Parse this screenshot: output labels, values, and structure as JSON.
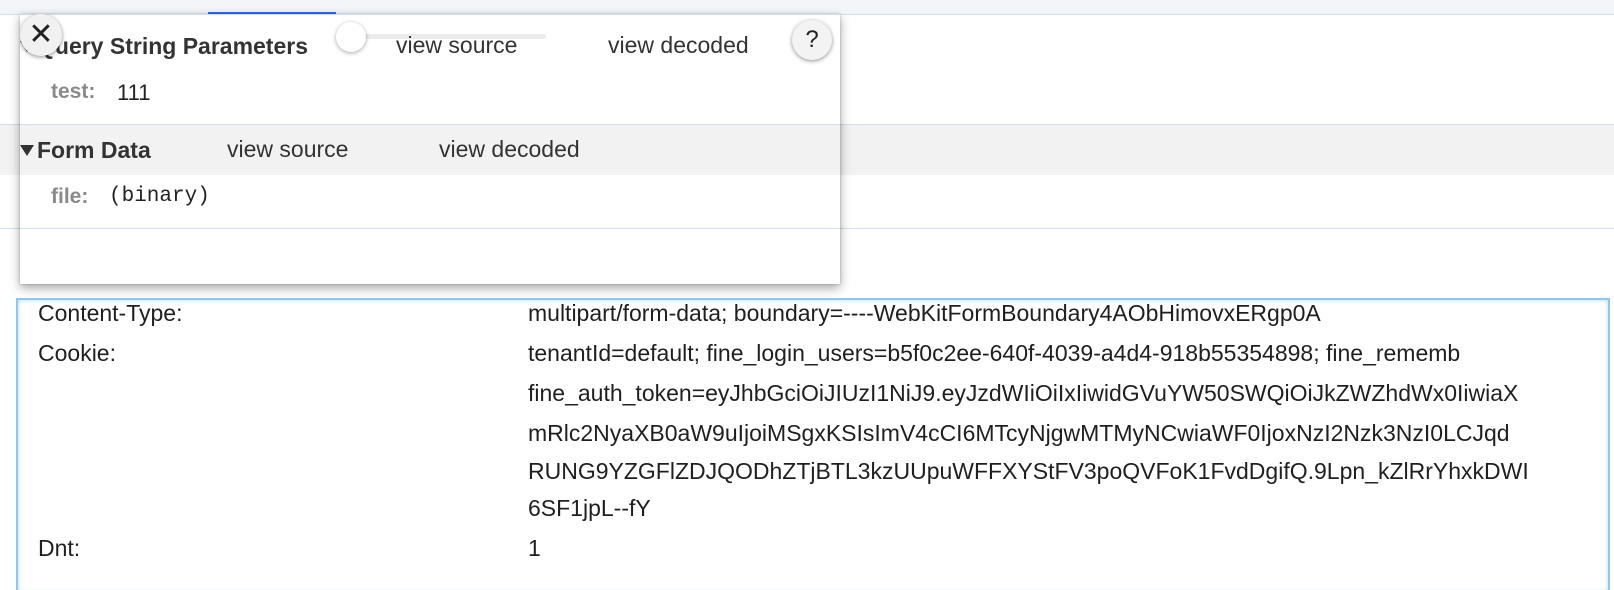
{
  "popup": {
    "query_section": {
      "title": "Query String Parameters",
      "view_source": "view source",
      "view_decoded": "view decoded",
      "params": [
        {
          "key": "test:",
          "value": "111"
        }
      ]
    },
    "form_section": {
      "title": "Form Data",
      "view_source": "view source",
      "view_decoded": "view decoded",
      "params": [
        {
          "key": "file:",
          "value": "(binary)"
        }
      ]
    },
    "close_glyph": "✕",
    "help_glyph": "?"
  },
  "headers": [
    {
      "name": "Content-Type:",
      "value": "multipart/form-data; boundary=----WebKitFormBoundary4AObHimovxERgp0A"
    },
    {
      "name": "Cookie:",
      "lines": [
        "tenantId=default; fine_login_users=b5f0c2ee-640f-4039-a4d4-918b55354898; fine_rememb",
        "fine_auth_token=eyJhbGciOiJIUzI1NiJ9.eyJzdWIiOiIxIiwidGVuYW50SWQiOiJkZWZhdWx0IiwiaX",
        "mRlc2NyaXB0aW9uIjoiMSgxKSIsImV4cCI6MTcyNjgwMTMyNCwiaWF0IjoxNzI2Nzk3NzI0LCJqd",
        "RUNG9YZGFlZDJQODhZTjBTL3kzUUpuWFFXYStFV3poQVFoK1FvdDgifQ.9Lpn_kZlRrYhxkDWI",
        "6SF1jpL--fY"
      ]
    },
    {
      "name": "Dnt:",
      "value": "1"
    }
  ]
}
